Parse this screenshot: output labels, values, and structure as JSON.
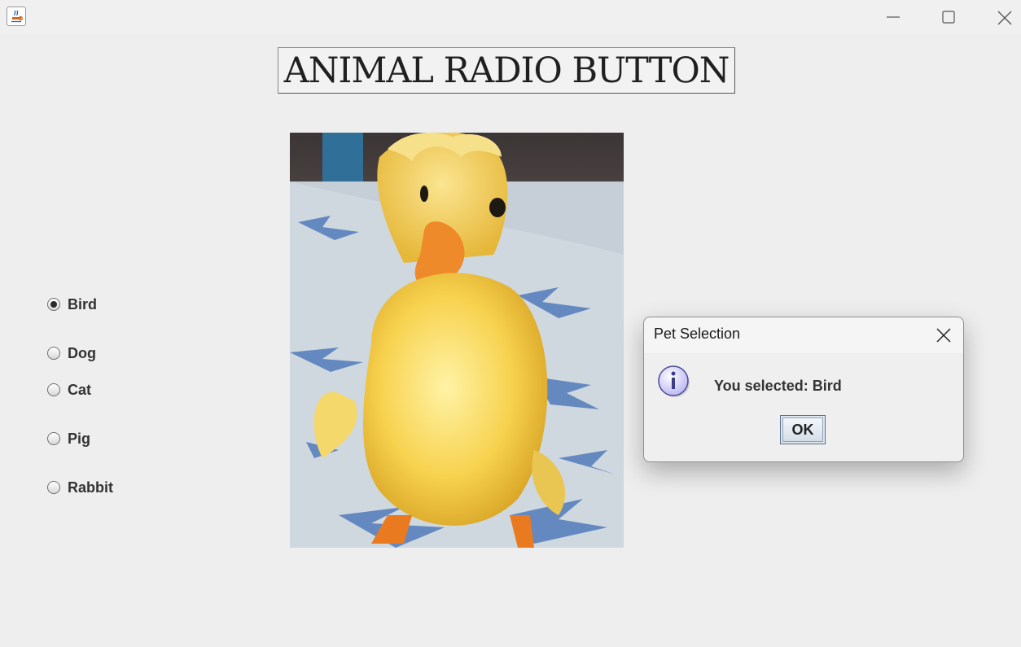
{
  "window": {
    "title": "",
    "controls": [
      "minimize-icon",
      "maximize-icon",
      "close-icon"
    ]
  },
  "heading": {
    "text": "ANIMAL RADIO BUTTON"
  },
  "pets": {
    "options": [
      "Bird",
      "Dog",
      "Cat",
      "Pig",
      "Rabbit"
    ],
    "selected": "Bird"
  },
  "image": {
    "subject": "duckling"
  },
  "dialog": {
    "title": "Pet Selection",
    "icon": "info-icon",
    "message": "You selected: Bird",
    "ok_label": "OK"
  }
}
